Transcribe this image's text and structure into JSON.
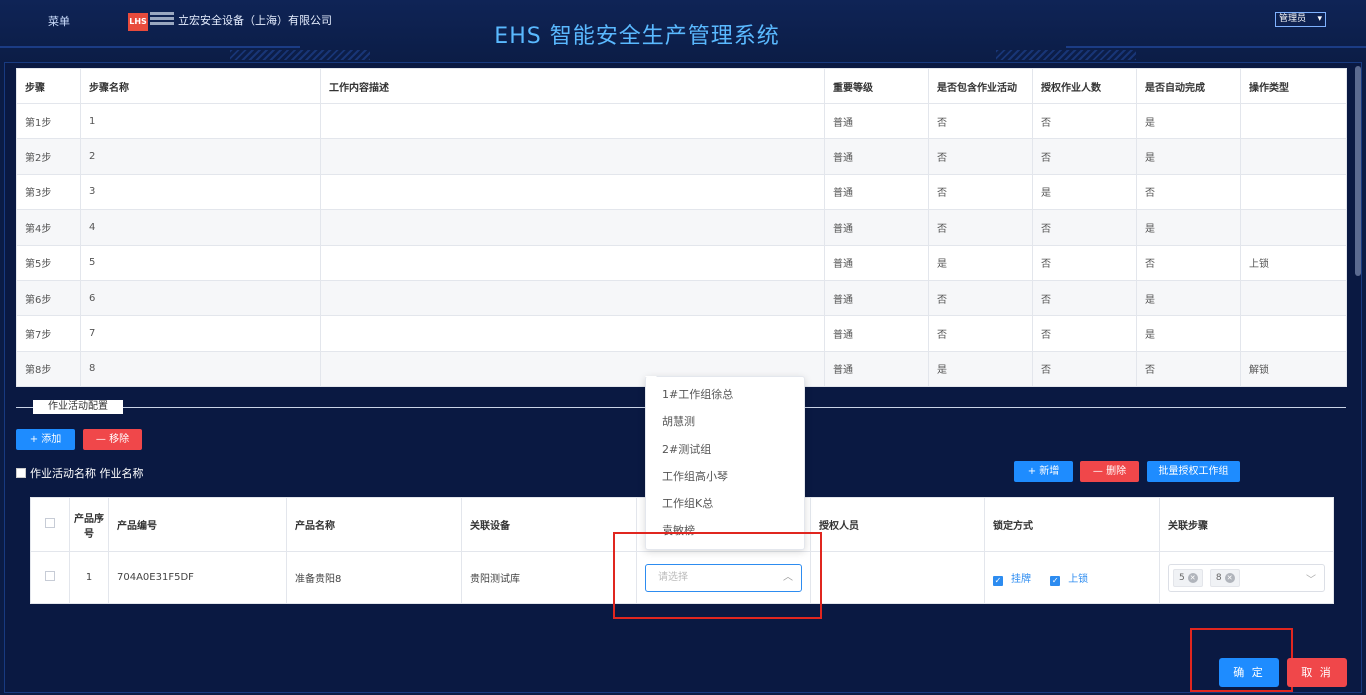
{
  "header": {
    "menu_label": "菜单",
    "logo_text": "LHS",
    "company": "立宏安全设备（上海）有限公司",
    "system_title": "EHS 智能安全生产管理系统",
    "user_menu": "管理员"
  },
  "steps_table": {
    "columns": [
      "步骤",
      "步骤名称",
      "工作内容描述",
      "重要等级",
      "是否包含作业活动",
      "授权作业人数",
      "是否自动完成",
      "操作类型"
    ],
    "rows": [
      [
        "第1步",
        "1",
        "",
        "普通",
        "否",
        "否",
        "是",
        ""
      ],
      [
        "第2步",
        "2",
        "",
        "普通",
        "否",
        "否",
        "是",
        ""
      ],
      [
        "第3步",
        "3",
        "",
        "普通",
        "否",
        "是",
        "否",
        ""
      ],
      [
        "第4步",
        "4",
        "",
        "普通",
        "否",
        "否",
        "是",
        ""
      ],
      [
        "第5步",
        "5",
        "",
        "普通",
        "是",
        "否",
        "否",
        "上锁"
      ],
      [
        "第6步",
        "6",
        "",
        "普通",
        "否",
        "否",
        "是",
        ""
      ],
      [
        "第7步",
        "7",
        "",
        "普通",
        "否",
        "否",
        "是",
        ""
      ],
      [
        "第8步",
        "8",
        "",
        "普通",
        "是",
        "否",
        "否",
        "解锁"
      ]
    ]
  },
  "activity_section": {
    "title": "作业活动配置",
    "add_label": "+ 添加",
    "remove_label": "— 移除",
    "checkbox_label": "作业活动名称 作业名称",
    "new_label": "+ 新增",
    "delete_label": "— 删除",
    "batch_label": "批量授权工作组"
  },
  "products_table": {
    "columns": [
      "",
      "产品序号",
      "产品编号",
      "产品名称",
      "关联设备",
      "",
      "授权人员",
      "锁定方式",
      "关联步骤"
    ],
    "row": {
      "index": "1",
      "code": "704A0E31F5DF",
      "name": "准备贵阳8",
      "device": "贵阳测试库",
      "select_placeholder": "请选择",
      "lock_options": [
        "挂牌",
        "上锁"
      ],
      "step_tags": [
        "5",
        "8"
      ]
    }
  },
  "dropdown": {
    "items": [
      "1#工作组徐总",
      "胡慧测",
      "2#测试组",
      "工作组高小琴",
      "工作组K总",
      "袁敏榜"
    ]
  },
  "footer": {
    "confirm_label": "确 定",
    "cancel_label": "取 消"
  },
  "colors": {
    "primary": "#1e8cff",
    "danger": "#f0474a",
    "highlight": "#e0261f",
    "background": "#0b1c45",
    "title": "#5ab9ff"
  }
}
